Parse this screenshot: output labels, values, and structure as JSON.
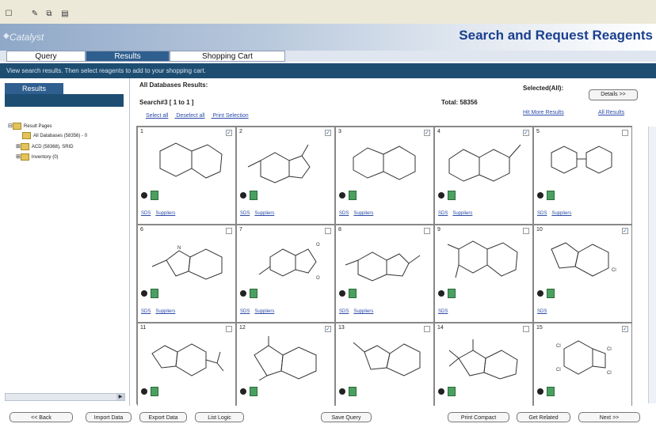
{
  "app": {
    "title": "Search and Request Reagents",
    "logo": "Catalyst"
  },
  "tabs": [
    {
      "label": "Query",
      "active": false
    },
    {
      "label": "Results",
      "active": true
    },
    {
      "label": "Shopping Cart",
      "active": false
    }
  ],
  "instruction": "View search results. Then select reagents to add to your shopping cart.",
  "left_panel": {
    "tab_label": "Results",
    "tree": [
      {
        "label": "Result Pages"
      },
      {
        "label": "All Databases (58356) - 0"
      },
      {
        "label": "ACD (58368), SRID"
      },
      {
        "label": "Inventory (0)"
      }
    ]
  },
  "main": {
    "heading": "All Databases Results:",
    "search_label": "Search#3 [ 1 to 1 ]",
    "total_label": "Total: 58356",
    "selected_label": "Selected(All):",
    "details_button": "Details >>",
    "links": [
      "Select all",
      "Deselect all",
      "Print Selection"
    ],
    "nav_links": [
      "Hit More Results",
      "All Results"
    ]
  },
  "results": [
    {
      "num": "1",
      "links": [
        "SDS",
        "Suppliers"
      ],
      "checked": true
    },
    {
      "num": "2",
      "links": [
        "SDS",
        "Suppliers"
      ],
      "checked": true
    },
    {
      "num": "3",
      "links": [
        "SDS",
        "Suppliers"
      ],
      "checked": true
    },
    {
      "num": "4",
      "links": [
        "SDS",
        "Suppliers"
      ],
      "checked": true
    },
    {
      "num": "5",
      "links": [
        "SDS",
        "Suppliers"
      ],
      "checked": false
    },
    {
      "num": "6",
      "links": [
        "SDS",
        "Suppliers"
      ],
      "checked": false
    },
    {
      "num": "7",
      "links": [
        "SDS",
        "Suppliers"
      ],
      "checked": false
    },
    {
      "num": "8",
      "links": [
        "SDS",
        "Suppliers"
      ],
      "checked": false
    },
    {
      "num": "9",
      "links": [
        "SDS"
      ],
      "checked": false
    },
    {
      "num": "10",
      "links": [
        "SDS"
      ],
      "checked": true
    },
    {
      "num": "11",
      "links": [],
      "checked": false
    },
    {
      "num": "12",
      "links": [],
      "checked": true
    },
    {
      "num": "13",
      "links": [],
      "checked": false
    },
    {
      "num": "14",
      "links": [],
      "checked": false
    },
    {
      "num": "15",
      "links": [],
      "checked": true
    }
  ],
  "footer": {
    "buttons": [
      "<< Back",
      "Import Data",
      "Export Data",
      "List Logic",
      "Save Query",
      "Print Compact",
      "Get Related",
      "Next >>"
    ]
  },
  "icons": {
    "toolbar": [
      "new-icon",
      "edit-icon",
      "copy-icon",
      "print-icon"
    ]
  }
}
